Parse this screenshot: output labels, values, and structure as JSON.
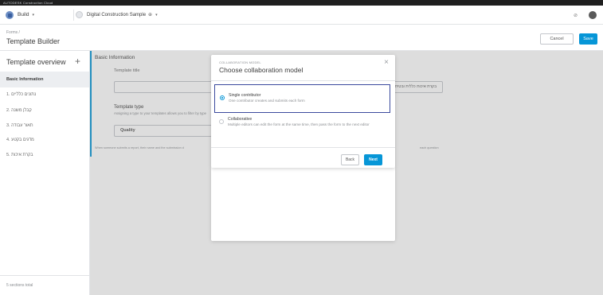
{
  "topbar": {
    "brand": "AUTODESK Construction Cloud"
  },
  "appbar": {
    "product": "Build",
    "project": "Digital Construction Sample",
    "project_badge": "⊕",
    "chevron": "▾",
    "help": "⊘"
  },
  "page": {
    "breadcrumb": "Forms /",
    "title": "Template Builder",
    "cancel_label": "Cancel",
    "save_label": "Save"
  },
  "sidebar": {
    "header": "Template overview",
    "add": "+",
    "items": [
      {
        "label": "Basic Information"
      },
      {
        "label": "1. נתונים כלליים"
      },
      {
        "label": "2. קבלן משנה"
      },
      {
        "label": "3. תאור עבודה"
      },
      {
        "label": "4. מדגים בקטע"
      },
      {
        "label": "5. בקרת איכות"
      }
    ],
    "footer": "5 sections total"
  },
  "form": {
    "section_title": "Basic Information",
    "template_title_label": "Template title",
    "template_title_value": "בקרת איכות כללית ובטיחות",
    "type_label": "Template type",
    "type_help": "Assigning a type to your templates allows you to filter by type",
    "type_value": "Quality",
    "note_left": "When someone submits a report, their name and the submission d",
    "note_right": "each question"
  },
  "modal": {
    "overline": "COLLABORATION MODEL",
    "title": "Choose collaboration model",
    "close": "×",
    "options": [
      {
        "title": "Single contributor",
        "desc": "One contributor creates and submits each form"
      },
      {
        "title": "Collaborative",
        "desc": "Multiple editors can edit the form at the same time, then pass the form to the next editor"
      }
    ],
    "back_label": "Back",
    "next_label": "Next"
  }
}
